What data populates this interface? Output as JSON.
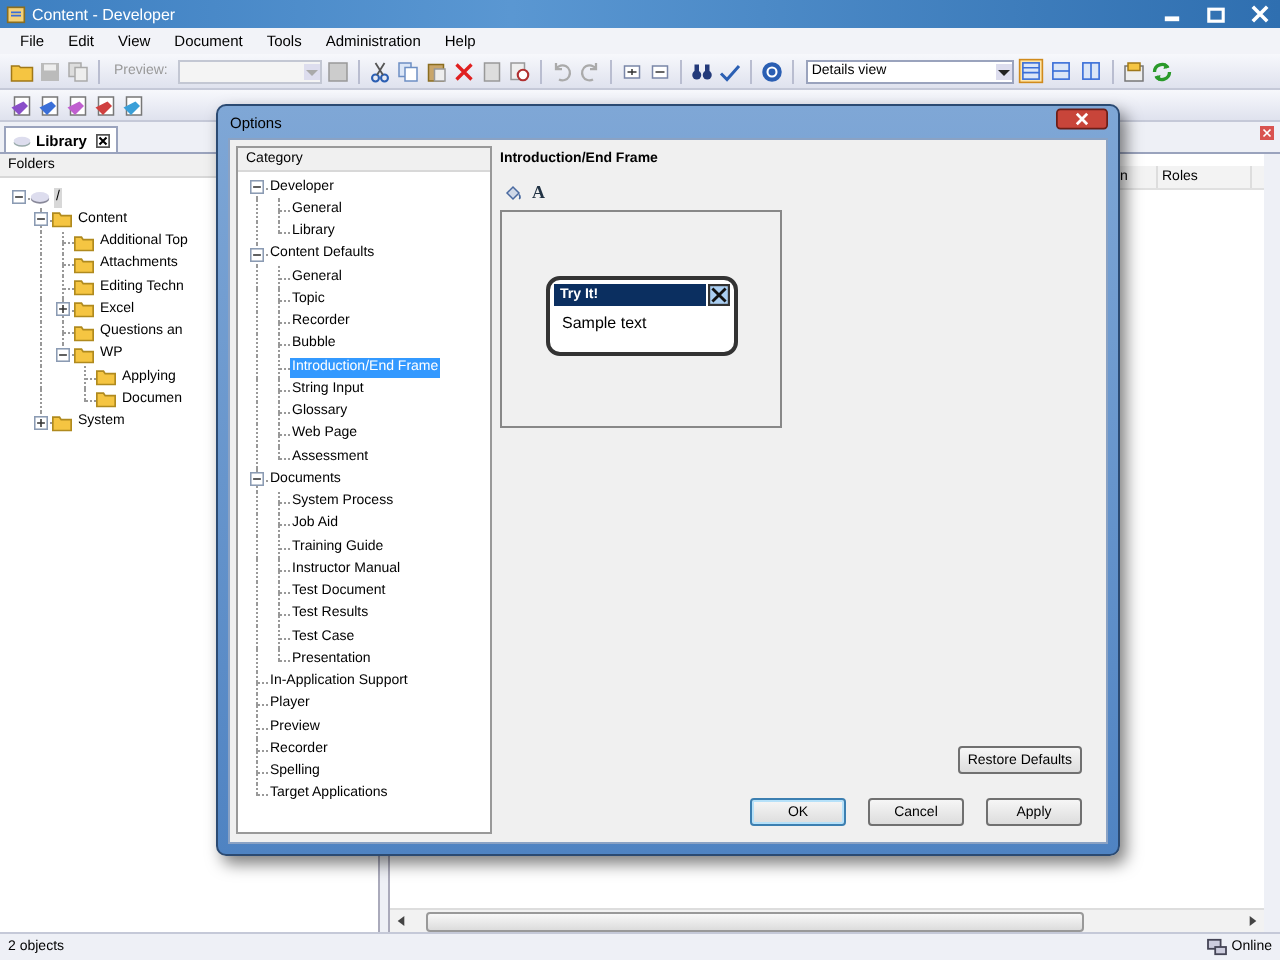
{
  "window": {
    "title": "Content - Developer"
  },
  "menu": [
    "File",
    "Edit",
    "View",
    "Document",
    "Tools",
    "Administration",
    "Help"
  ],
  "toolbar": {
    "preview_label": "Preview:",
    "view_combo": "Details view",
    "view_buttons": [
      {
        "selected": true
      },
      {
        "selected": false
      },
      {
        "selected": false
      }
    ]
  },
  "tabs": [
    {
      "label": "Library",
      "selected": true
    }
  ],
  "folders": {
    "header": "Folders",
    "tree": [
      {
        "label": "/",
        "selected": true,
        "expanded": true,
        "children": [
          {
            "label": "Content",
            "selected": false,
            "expanded": true,
            "children": [
              {
                "label": "Additional Top",
                "selected": false
              },
              {
                "label": "Attachments",
                "selected": false
              },
              {
                "label": "Editing Techn",
                "selected": false
              },
              {
                "label": "Excel",
                "selected": false,
                "expanded": false
              },
              {
                "label": "Questions an",
                "selected": false
              },
              {
                "label": "WP",
                "selected": false,
                "expanded": true,
                "children": [
                  {
                    "label": "Applying",
                    "selected": false
                  },
                  {
                    "label": "Documen",
                    "selected": false
                  }
                ]
              }
            ]
          },
          {
            "label": "System",
            "selected": false,
            "expanded": false
          }
        ]
      }
    ]
  },
  "list": {
    "columns": [
      "n",
      "Roles"
    ]
  },
  "dialog": {
    "title": "Options",
    "category_header": "Category",
    "categories": [
      {
        "label": "Developer",
        "selected": false,
        "expanded": true,
        "children": [
          {
            "label": "General",
            "selected": false
          },
          {
            "label": "Library",
            "selected": false
          }
        ]
      },
      {
        "label": "Content Defaults",
        "selected": false,
        "expanded": true,
        "children": [
          {
            "label": "General",
            "selected": false
          },
          {
            "label": "Topic",
            "selected": false
          },
          {
            "label": "Recorder",
            "selected": false
          },
          {
            "label": "Bubble",
            "selected": false
          },
          {
            "label": "Introduction/End Frame",
            "selected": true
          },
          {
            "label": "String Input",
            "selected": false
          },
          {
            "label": "Glossary",
            "selected": false
          },
          {
            "label": "Web Page",
            "selected": false
          },
          {
            "label": "Assessment",
            "selected": false
          }
        ]
      },
      {
        "label": "Documents",
        "selected": false,
        "expanded": true,
        "children": [
          {
            "label": "System Process",
            "selected": false
          },
          {
            "label": "Job Aid",
            "selected": false
          },
          {
            "label": "Training Guide",
            "selected": false
          },
          {
            "label": "Instructor Manual",
            "selected": false
          },
          {
            "label": "Test Document",
            "selected": false
          },
          {
            "label": "Test Results",
            "selected": false
          },
          {
            "label": "Test Case",
            "selected": false
          },
          {
            "label": "Presentation",
            "selected": false
          }
        ]
      },
      {
        "label": "In-Application Support",
        "selected": false
      },
      {
        "label": "Player",
        "selected": false
      },
      {
        "label": "Preview",
        "selected": false
      },
      {
        "label": "Recorder",
        "selected": false
      },
      {
        "label": "Spelling",
        "selected": false
      },
      {
        "label": "Target Applications",
        "selected": false
      }
    ],
    "section_title": "Introduction/End Frame",
    "font_icon": "A",
    "preview": {
      "title": "Try It!",
      "body": "Sample text"
    },
    "restore_button": "Restore Defaults",
    "buttons": [
      {
        "label": "OK",
        "default": true
      },
      {
        "label": "Cancel",
        "default": false
      },
      {
        "label": "Apply",
        "default": false
      }
    ]
  },
  "status_bar": {
    "left": "2 objects",
    "right": "Online"
  }
}
